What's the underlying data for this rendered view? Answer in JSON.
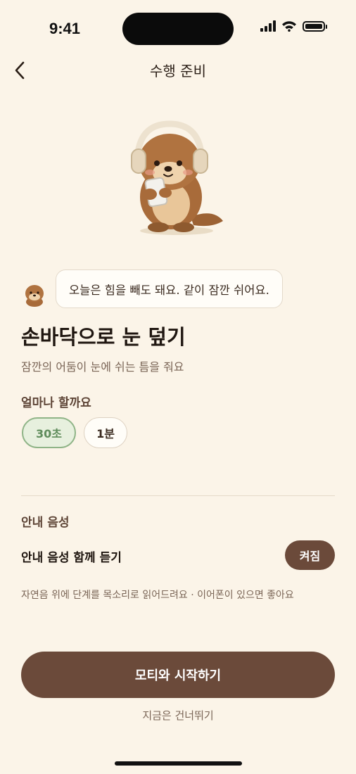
{
  "status_bar": {
    "time": "9:41"
  },
  "header": {
    "title": "수행 준비",
    "back_icon": "chevron-left-icon"
  },
  "hero": {
    "illustration": "otter-with-headphones-and-phone"
  },
  "bubble": {
    "avatar": "otter-avatar",
    "message": "오늘은 힘을 빼도 돼요. 같이 잠깐 쉬어요."
  },
  "exercise": {
    "title": "손바닥으로 눈 덮기",
    "subtitle": "잠깐의 어둠이 눈에 쉬는 틈을 줘요"
  },
  "duration": {
    "label": "얼마나 할까요",
    "options": [
      {
        "label": "30초",
        "selected": true
      },
      {
        "label": "1분",
        "selected": false
      }
    ]
  },
  "voice": {
    "section_label": "안내 음성",
    "row_label": "안내 음성 함께 듣기",
    "toggle_label": "켜짐",
    "description": "자연음 위에 단계를 목소리로 읽어드려요 · 이어폰이 있으면 좋아요"
  },
  "actions": {
    "start_label": "모티와 시작하기",
    "skip_label": "지금은 건너뛰기"
  },
  "colors": {
    "background": "#fbf4e8",
    "primary": "#6b4a3a",
    "selected_chip_bg": "#e7f0de",
    "selected_chip_border": "#8fb487"
  }
}
